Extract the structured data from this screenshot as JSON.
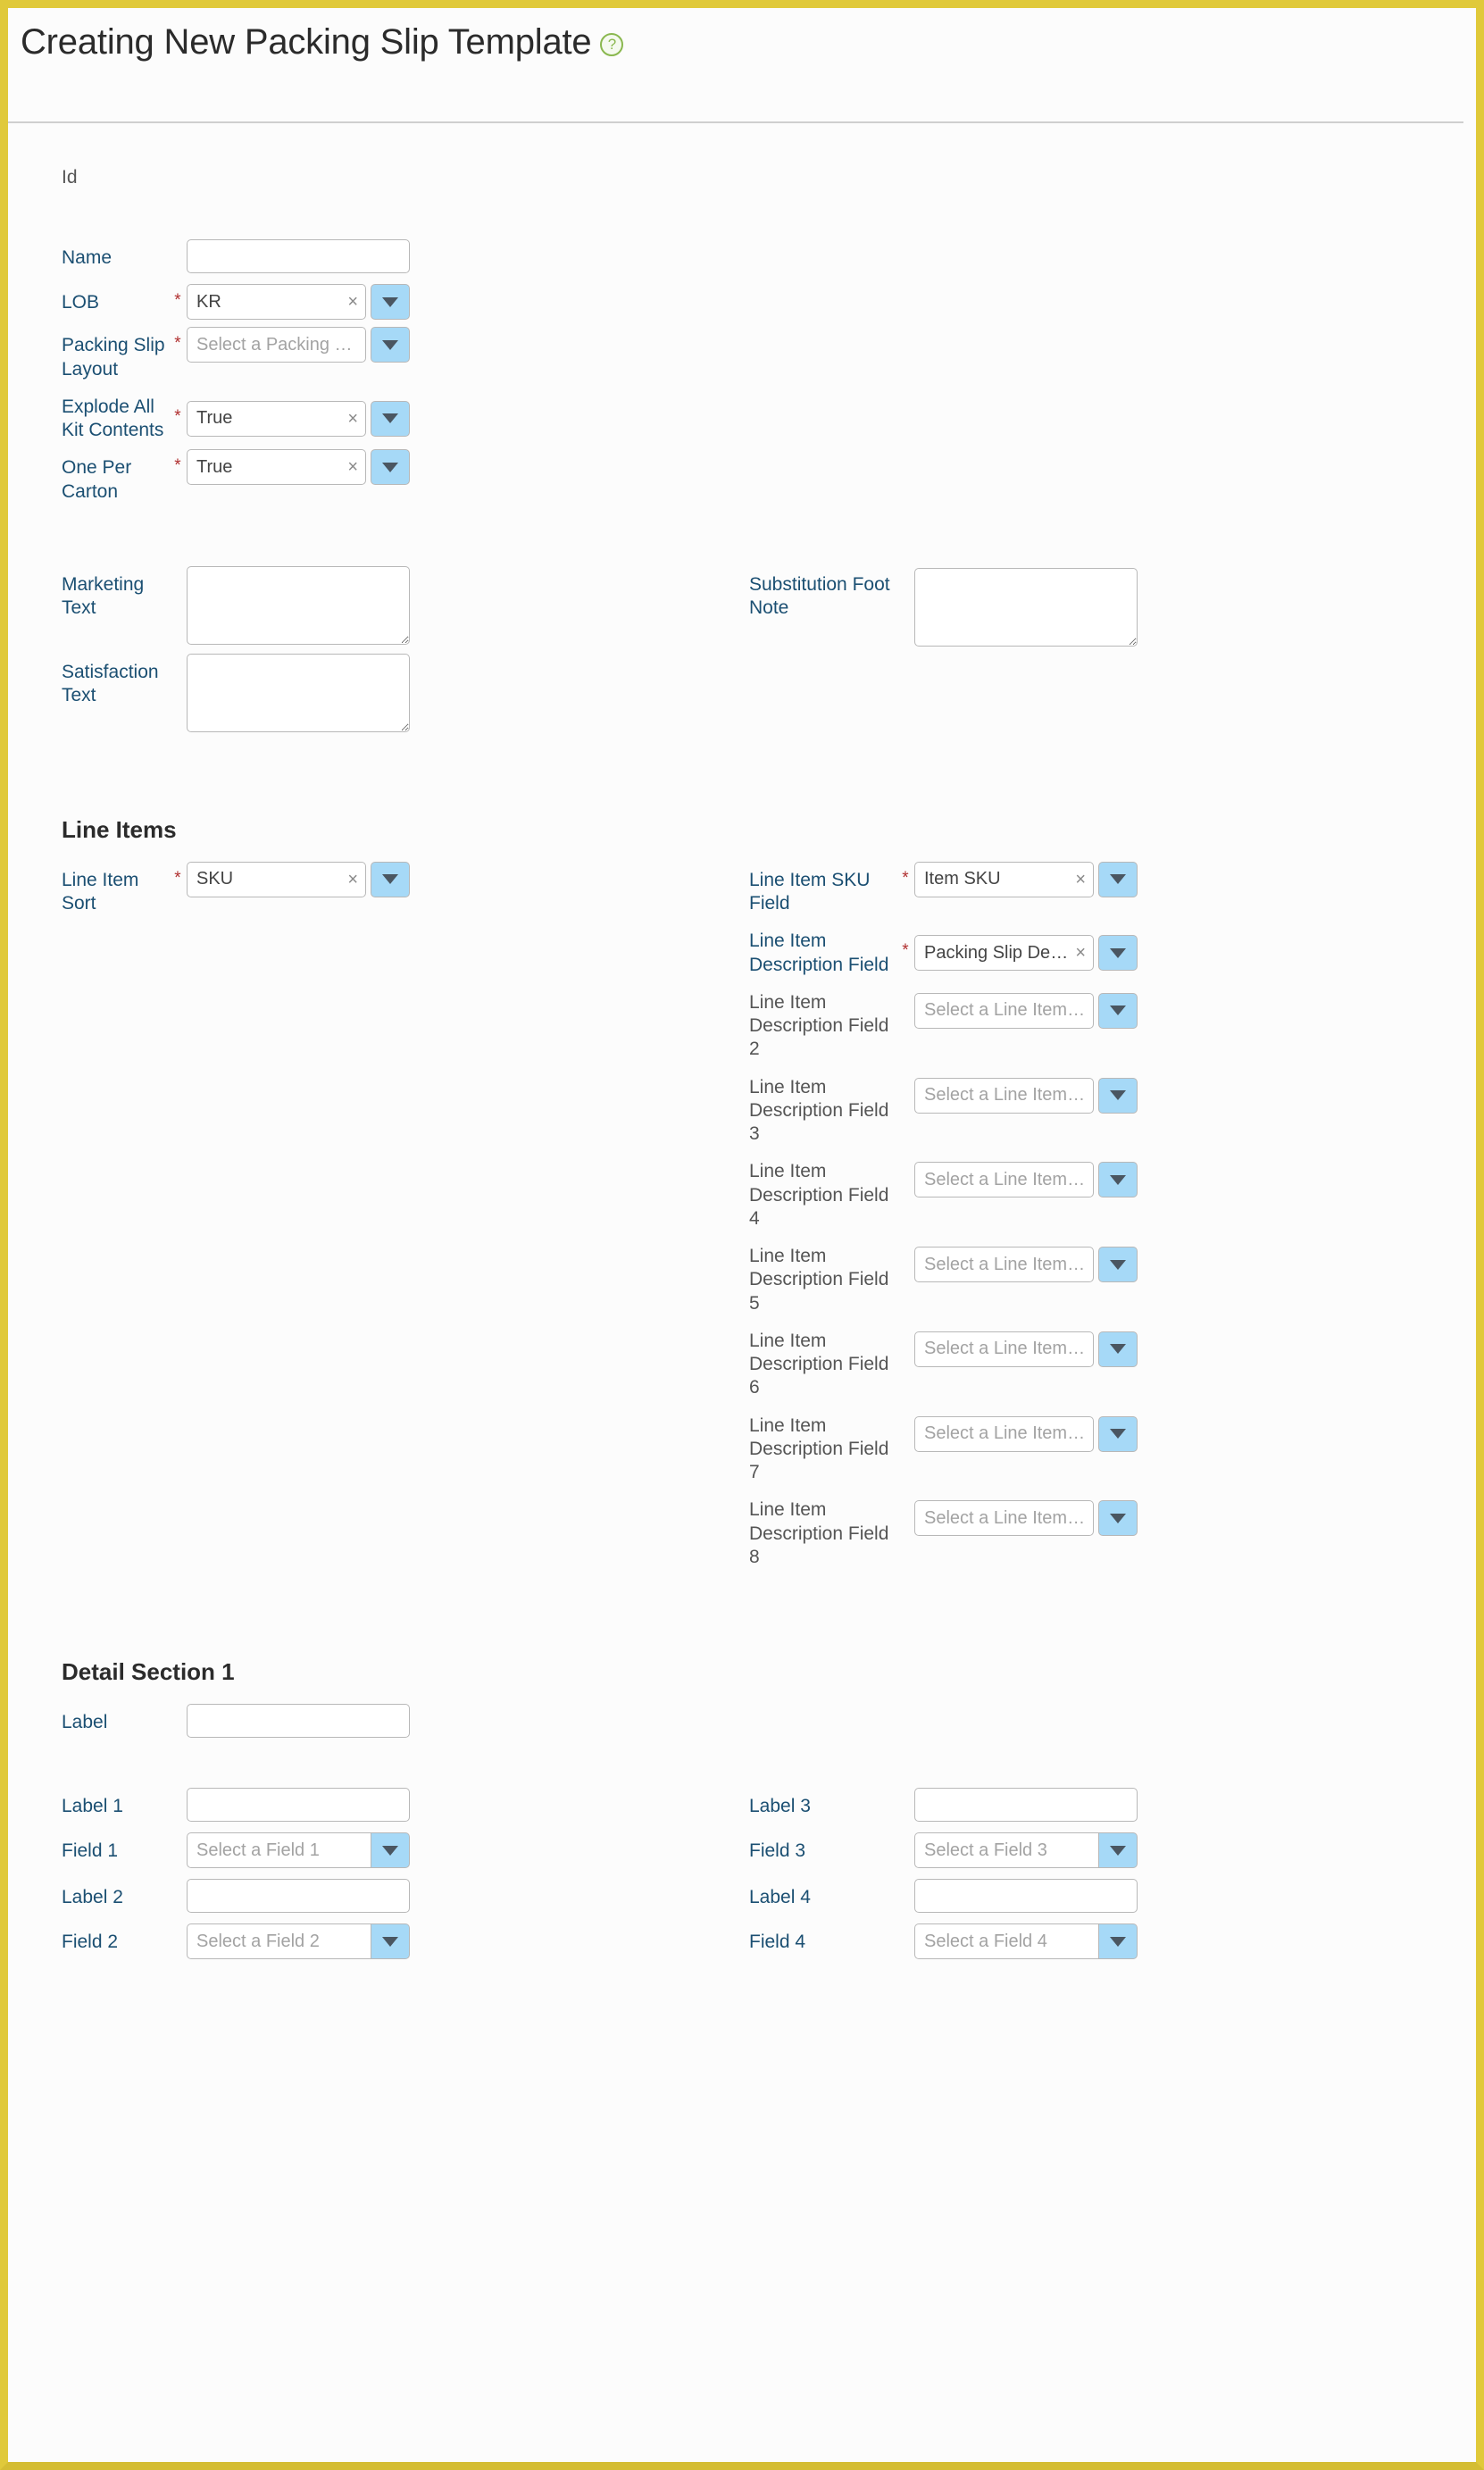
{
  "header": {
    "title": "Creating New Packing Slip Template",
    "help_icon": "help-circle-icon",
    "help_glyph": "?"
  },
  "glyphs": {
    "required_star": "*",
    "clear": "×"
  },
  "general": {
    "id_label": "Id",
    "name": {
      "label": "Name",
      "value": "",
      "placeholder": ""
    },
    "lob": {
      "label": "LOB",
      "value": "KR",
      "required": true
    },
    "packing_slip_layout": {
      "label": "Packing Slip Layout",
      "value": "",
      "placeholder": "Select a Packing Slip Layout",
      "required": true
    },
    "explode_all_kit_contents": {
      "label": "Explode All Kit Contents",
      "value": "True",
      "required": true
    },
    "one_per_carton": {
      "label": "One Per Carton",
      "value": "True",
      "required": true
    },
    "marketing_text": {
      "label": "Marketing Text",
      "value": ""
    },
    "substitution_foot_note": {
      "label": "Substitution Foot Note",
      "value": ""
    },
    "satisfaction_text": {
      "label": "Satisfaction Text",
      "value": ""
    }
  },
  "line_items": {
    "title": "Line Items",
    "line_item_sort": {
      "label": "Line Item Sort",
      "value": "SKU",
      "required": true
    },
    "sku_field": {
      "label": "Line Item SKU Field",
      "value": "Item SKU",
      "required": true
    },
    "description_fields": [
      {
        "label": "Line Item Description Field",
        "value": "Packing Slip Description",
        "placeholder": "",
        "required": true
      },
      {
        "label": "Line Item Description Field 2",
        "value": "",
        "placeholder": "Select a Line Item Descriptio...",
        "required": false
      },
      {
        "label": "Line Item Description Field 3",
        "value": "",
        "placeholder": "Select a Line Item Descriptio...",
        "required": false
      },
      {
        "label": "Line Item Description Field 4",
        "value": "",
        "placeholder": "Select a Line Item Descriptio...",
        "required": false
      },
      {
        "label": "Line Item Description Field 5",
        "value": "",
        "placeholder": "Select a Line Item Descriptio...",
        "required": false
      },
      {
        "label": "Line Item Description Field 6",
        "value": "",
        "placeholder": "Select a Line Item Descriptio...",
        "required": false
      },
      {
        "label": "Line Item Description Field 7",
        "value": "",
        "placeholder": "Select a Line Item Descriptio...",
        "required": false
      },
      {
        "label": "Line Item Description Field 8",
        "value": "",
        "placeholder": "Select a Line Item Descriptio...",
        "required": false
      }
    ]
  },
  "detail_section_1": {
    "title": "Detail Section 1",
    "label": {
      "label": "Label",
      "value": ""
    },
    "label_1": {
      "label": "Label 1",
      "value": ""
    },
    "label_2": {
      "label": "Label 2",
      "value": ""
    },
    "label_3": {
      "label": "Label 3",
      "value": ""
    },
    "label_4": {
      "label": "Label 4",
      "value": ""
    },
    "field_1": {
      "label": "Field 1",
      "value": "",
      "placeholder": "Select a Field 1"
    },
    "field_2": {
      "label": "Field 2",
      "value": "",
      "placeholder": "Select a Field 2"
    },
    "field_3": {
      "label": "Field 3",
      "value": "",
      "placeholder": "Select a Field 3"
    },
    "field_4": {
      "label": "Field 4",
      "value": "",
      "placeholder": "Select a Field 4"
    }
  },
  "colors": {
    "frame_border": "#e0c93a",
    "label_link": "#1b4f72",
    "label_muted": "#555555",
    "required_star": "#b03030",
    "dropdown_button": "#a6d9f7",
    "help_icon": "#8ab84f"
  }
}
